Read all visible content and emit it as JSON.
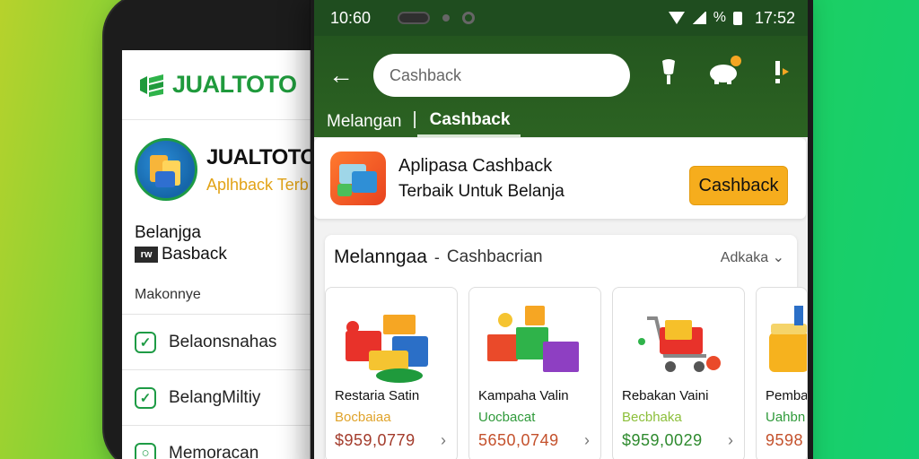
{
  "back_phone": {
    "logo": "JUALTOTO",
    "profile_name": "JUALTOTO",
    "profile_sub": "Aplhback Terb",
    "section_line1": "Belanjga",
    "section_line2": "Basback",
    "small_heading": "Makonnye",
    "menu": [
      {
        "label": "Belaonsnahas",
        "icon": "check-shield-icon"
      },
      {
        "label": "BelangMiltiy",
        "icon": "check-box-icon"
      },
      {
        "label": "Memoracan",
        "icon": "camera-icon"
      }
    ]
  },
  "status_bar": {
    "time_left": "10:60",
    "time_right": "17:52",
    "battery_text": "%"
  },
  "app_bar": {
    "search_placeholder": "Cashback",
    "tabs": [
      {
        "label": "Melangan",
        "active": false
      },
      {
        "label": "Cashback",
        "active": true
      }
    ]
  },
  "promo": {
    "title": "Aplipasa Cashback",
    "subtitle": "Terbaik Untuk Belanja",
    "button_label": "Cashback"
  },
  "section": {
    "title": "Melanngaa",
    "separator": "-",
    "subtitle": "Cashbacrian",
    "more_label": "Adkaka"
  },
  "products": [
    {
      "title": "Restaria Satin",
      "tag": "Bocbaiaa",
      "tag_color": "#e0a32a",
      "price": "$959,0779"
    },
    {
      "title": "Kampaha Valin",
      "tag": "Uocbacat",
      "tag_color": "#2f9a3a",
      "price": "5650,0749"
    },
    {
      "title": "Rebakan Vaini",
      "tag": "Becbhaka",
      "tag_color": "#8cbf3a",
      "price": "$959,0029"
    },
    {
      "title": "Pembac",
      "tag": "Uahbn",
      "tag_color": "#2f9a3a",
      "price": "9598"
    }
  ],
  "colors": {
    "brand_green": "#1f9a3c",
    "app_bar": "#24561f",
    "accent_yellow": "#f6ad1d"
  }
}
